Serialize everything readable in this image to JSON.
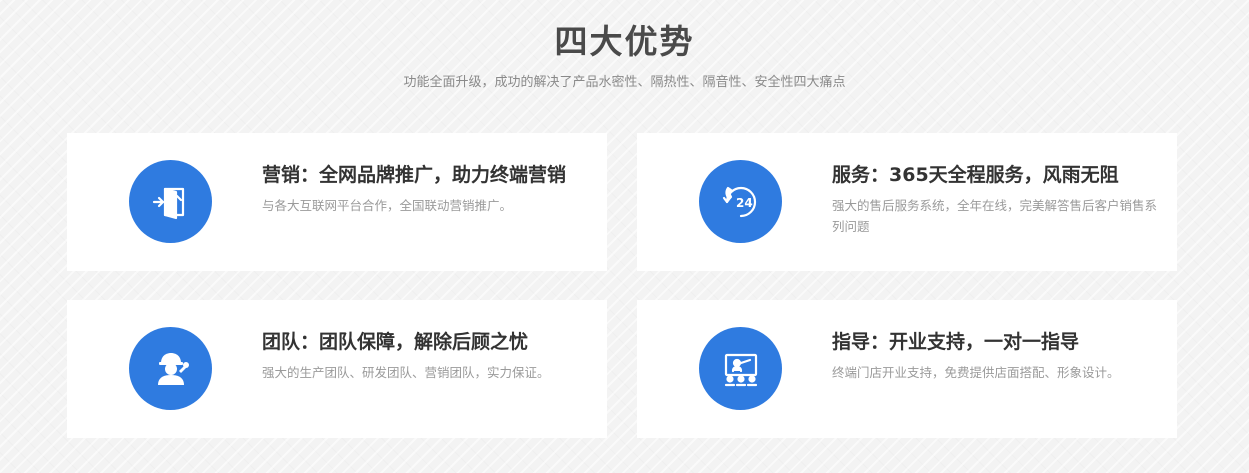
{
  "section": {
    "title": "四大优势",
    "subtitle": "功能全面升级，成功的解决了产品水密性、隔热性、隔音性、安全性四大痛点"
  },
  "colors": {
    "accent": "#2f7be0",
    "card_background": "#ffffff",
    "title_text": "#333333",
    "desc_text": "#9a9a9a"
  },
  "advantages": [
    {
      "icon": "door-exit-icon",
      "title": "营销：全网品牌推广，助力终端营销",
      "description": "与各大互联网平台合作，全国联动营销推广。"
    },
    {
      "icon": "phone-24h-icon",
      "title": "服务：365天全程服务，风雨无阻",
      "description": "强大的售后服务系统，全年在线，完美解答售后客户销售系列问题"
    },
    {
      "icon": "worker-wrench-icon",
      "title": "团队：团队保障，解除后顾之忧",
      "description": "强大的生产团队、研发团队、营销团队，实力保证。"
    },
    {
      "icon": "training-board-icon",
      "title": "指导：开业支持，一对一指导",
      "description": "终端门店开业支持，免费提供店面搭配、形象设计。"
    }
  ]
}
